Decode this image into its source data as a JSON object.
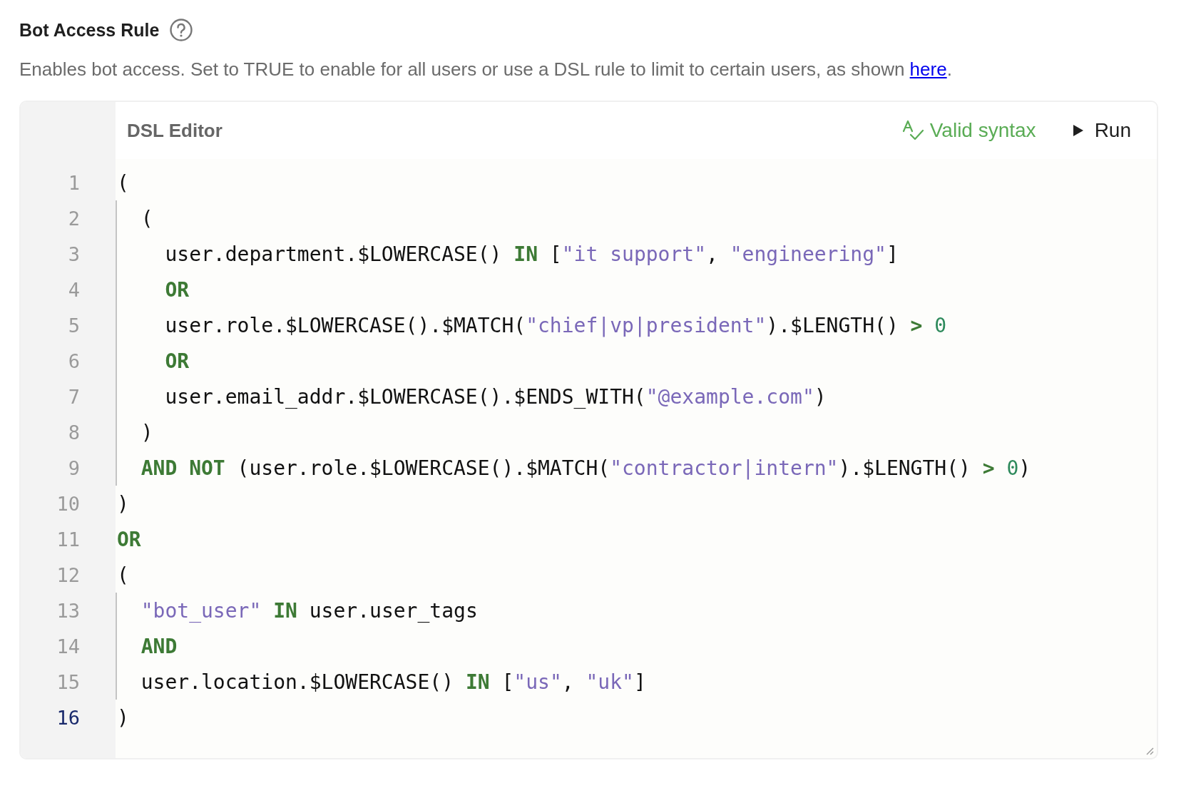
{
  "section": {
    "title": "Bot Access Rule",
    "description_before": "Enables bot access. Set to TRUE to enable for all users or use a DSL rule to limit to certain users, as shown ",
    "link": "here",
    "description_after": "."
  },
  "editor": {
    "title": "DSL Editor",
    "status": "Valid syntax",
    "run_label": "Run",
    "lines": [
      {
        "number": "1",
        "selected": false,
        "guide": false,
        "tokens": [
          {
            "kind": "plain",
            "text": "("
          }
        ]
      },
      {
        "number": "2",
        "selected": false,
        "guide": true,
        "tokens": [
          {
            "kind": "plain",
            "text": "  ("
          }
        ]
      },
      {
        "number": "3",
        "selected": false,
        "guide": true,
        "tokens": [
          {
            "kind": "plain",
            "text": "    user.department.$LOWERCASE() "
          },
          {
            "kind": "keyword",
            "text": "IN"
          },
          {
            "kind": "plain",
            "text": " ["
          },
          {
            "kind": "string",
            "text": "\"it support\""
          },
          {
            "kind": "plain",
            "text": ", "
          },
          {
            "kind": "string",
            "text": "\"engineering\""
          },
          {
            "kind": "plain",
            "text": "]"
          }
        ]
      },
      {
        "number": "4",
        "selected": false,
        "guide": true,
        "tokens": [
          {
            "kind": "keyword",
            "text": "    OR"
          }
        ]
      },
      {
        "number": "5",
        "selected": false,
        "guide": true,
        "tokens": [
          {
            "kind": "plain",
            "text": "    user.role.$LOWERCASE().$MATCH("
          },
          {
            "kind": "string",
            "text": "\"chief|vp|president\""
          },
          {
            "kind": "plain",
            "text": ").$LENGTH() "
          },
          {
            "kind": "keyword",
            "text": ">"
          },
          {
            "kind": "number",
            "text": " 0"
          }
        ]
      },
      {
        "number": "6",
        "selected": false,
        "guide": true,
        "tokens": [
          {
            "kind": "keyword",
            "text": "    OR"
          }
        ]
      },
      {
        "number": "7",
        "selected": false,
        "guide": true,
        "tokens": [
          {
            "kind": "plain",
            "text": "    user.email_addr.$LOWERCASE().$ENDS_WITH("
          },
          {
            "kind": "string",
            "text": "\"@example.com\""
          },
          {
            "kind": "plain",
            "text": ")"
          }
        ]
      },
      {
        "number": "8",
        "selected": false,
        "guide": true,
        "tokens": [
          {
            "kind": "plain",
            "text": "  )"
          }
        ]
      },
      {
        "number": "9",
        "selected": false,
        "guide": true,
        "tokens": [
          {
            "kind": "keyword",
            "text": "  AND NOT"
          },
          {
            "kind": "plain",
            "text": " (user.role.$LOWERCASE().$MATCH("
          },
          {
            "kind": "string",
            "text": "\"contractor|intern\""
          },
          {
            "kind": "plain",
            "text": ").$LENGTH() "
          },
          {
            "kind": "keyword",
            "text": ">"
          },
          {
            "kind": "number",
            "text": " 0"
          },
          {
            "kind": "plain",
            "text": ")"
          }
        ]
      },
      {
        "number": "10",
        "selected": false,
        "guide": false,
        "tokens": [
          {
            "kind": "plain",
            "text": ")"
          }
        ]
      },
      {
        "number": "11",
        "selected": false,
        "guide": false,
        "tokens": [
          {
            "kind": "keyword",
            "text": "OR"
          }
        ]
      },
      {
        "number": "12",
        "selected": false,
        "guide": false,
        "tokens": [
          {
            "kind": "plain",
            "text": "("
          }
        ]
      },
      {
        "number": "13",
        "selected": false,
        "guide": true,
        "tokens": [
          {
            "kind": "string",
            "text": "  \"bot_user\""
          },
          {
            "kind": "keyword",
            "text": " IN"
          },
          {
            "kind": "plain",
            "text": " user.user_tags"
          }
        ]
      },
      {
        "number": "14",
        "selected": false,
        "guide": true,
        "tokens": [
          {
            "kind": "keyword",
            "text": "  AND"
          }
        ]
      },
      {
        "number": "15",
        "selected": false,
        "guide": true,
        "tokens": [
          {
            "kind": "plain",
            "text": "  user.location.$LOWERCASE() "
          },
          {
            "kind": "keyword",
            "text": "IN"
          },
          {
            "kind": "plain",
            "text": " ["
          },
          {
            "kind": "string",
            "text": "\"us\""
          },
          {
            "kind": "plain",
            "text": ", "
          },
          {
            "kind": "string",
            "text": "\"uk\""
          },
          {
            "kind": "plain",
            "text": "]"
          }
        ]
      },
      {
        "number": "16",
        "selected": true,
        "guide": false,
        "tokens": [
          {
            "kind": "plain",
            "text": ")"
          }
        ]
      }
    ]
  }
}
